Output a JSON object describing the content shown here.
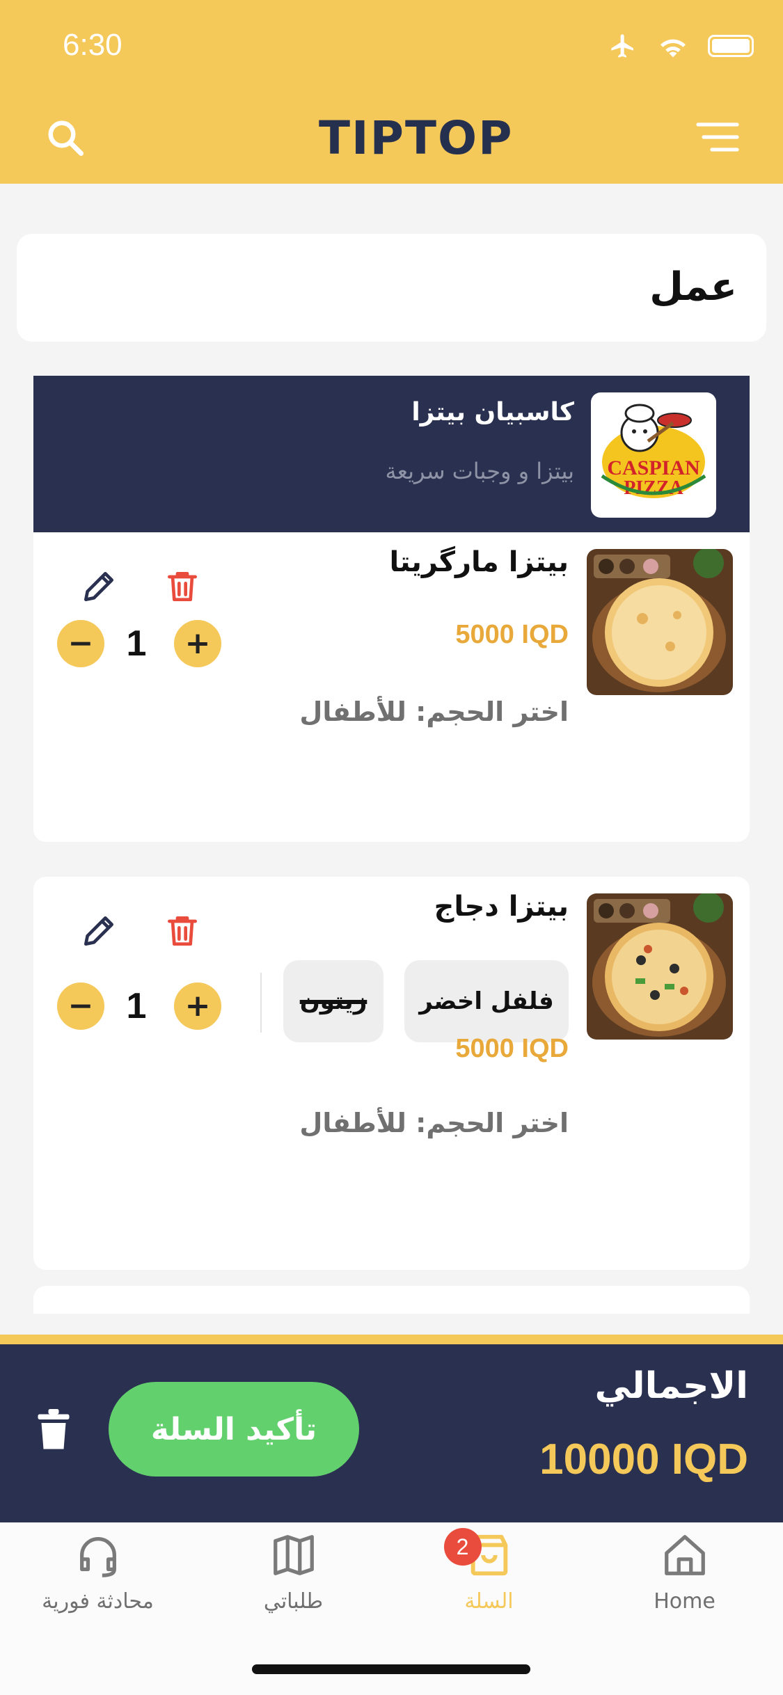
{
  "status": {
    "time": "6:30"
  },
  "header": {
    "logo": "TIPTOP"
  },
  "address": {
    "label": "عمل"
  },
  "restaurant": {
    "name": "كاسبيان بيتزا",
    "subtitle": "بيتزا و وجبات سريعة",
    "logo_text_top": "CASPIAN",
    "logo_text_bottom": "PIZZA"
  },
  "items": [
    {
      "name": "بيتزا مارگريتا",
      "price": "5000 IQD",
      "size": "اختر الحجم: للأطفال",
      "quantity": "1",
      "addons": []
    },
    {
      "name": "بيتزا دجاج",
      "price": "5000 IQD",
      "size": "اختر الحجم: للأطفال",
      "quantity": "1",
      "addons": [
        {
          "label": "فلفل اخضر",
          "removed": false
        },
        {
          "label": "زيتون",
          "removed": true
        }
      ]
    }
  ],
  "qty": {
    "minus": "−",
    "plus": "+"
  },
  "total": {
    "label": "الاجمالي",
    "value": "10000 IQD",
    "confirm_label": "تأكيد السلة"
  },
  "tabs": [
    {
      "label": "Home",
      "icon": "home-icon"
    },
    {
      "label": "السلة",
      "icon": "basket-icon",
      "badge": "2",
      "active": true
    },
    {
      "label": "طلباتي",
      "icon": "map-icon"
    },
    {
      "label": "محادثة فورية",
      "icon": "headset-icon"
    }
  ],
  "colors": {
    "primary": "#f5c85a",
    "navy": "#2a3150",
    "green": "#63d06e",
    "price": "#e8a93a",
    "delete": "#e94b3c"
  }
}
